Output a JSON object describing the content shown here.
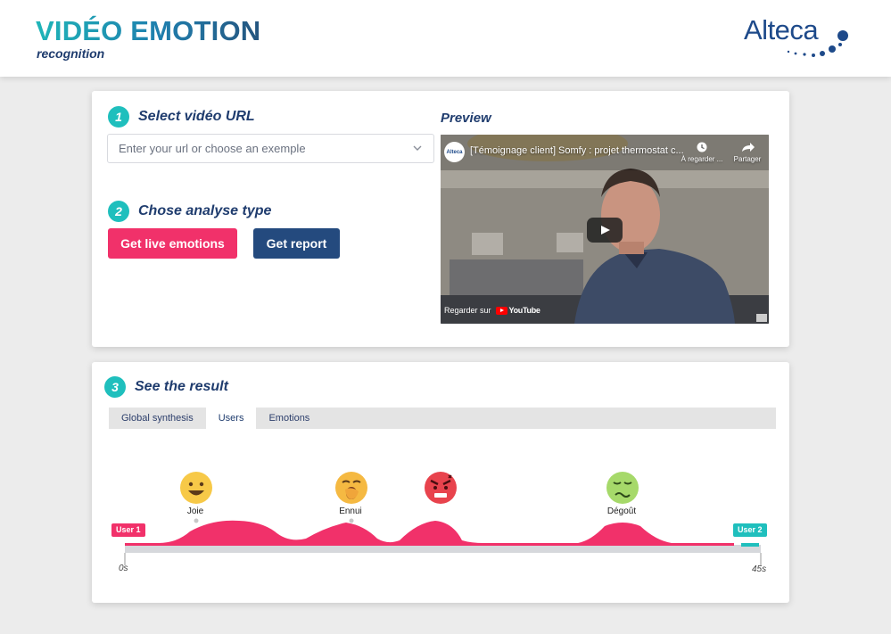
{
  "header": {
    "title": "VIDÉO EMOTION",
    "subtitle": "recognition",
    "logo_text": "Alteca"
  },
  "step1": {
    "number": "1",
    "label": "Select vidéo URL"
  },
  "url_select": {
    "placeholder": "Enter your url or choose an exemple"
  },
  "step2": {
    "number": "2",
    "label": "Chose analyse type"
  },
  "buttons": {
    "live": "Get live emotions",
    "report": "Get report"
  },
  "preview": {
    "label": "Preview",
    "video_title": "[Témoignage client] Somfy : projet thermostat c...",
    "channel": "Alteca",
    "watch_later": "À regarder ...",
    "share": "Partager",
    "watch_on": "Regarder sur",
    "youtube": "YouTube"
  },
  "step3": {
    "number": "3",
    "label": "See the result"
  },
  "tabs": [
    {
      "label": "Global synthesis",
      "active": false
    },
    {
      "label": "Users",
      "active": true
    },
    {
      "label": "Emotions",
      "active": false
    }
  ],
  "timeline": {
    "start_label": "0s",
    "end_label": "45s",
    "user1": "User 1",
    "user2": "User 2",
    "emotions": [
      {
        "label": "Joie",
        "icon": "happy-face-icon"
      },
      {
        "label": "Ennui",
        "icon": "yawning-face-icon"
      },
      {
        "label": "",
        "icon": "angry-face-icon"
      },
      {
        "label": "Dégoût",
        "icon": "nauseated-face-icon"
      }
    ]
  },
  "colors": {
    "accent_teal": "#1fbfbd",
    "pink": "#f1316a",
    "navy": "#244a7e"
  }
}
